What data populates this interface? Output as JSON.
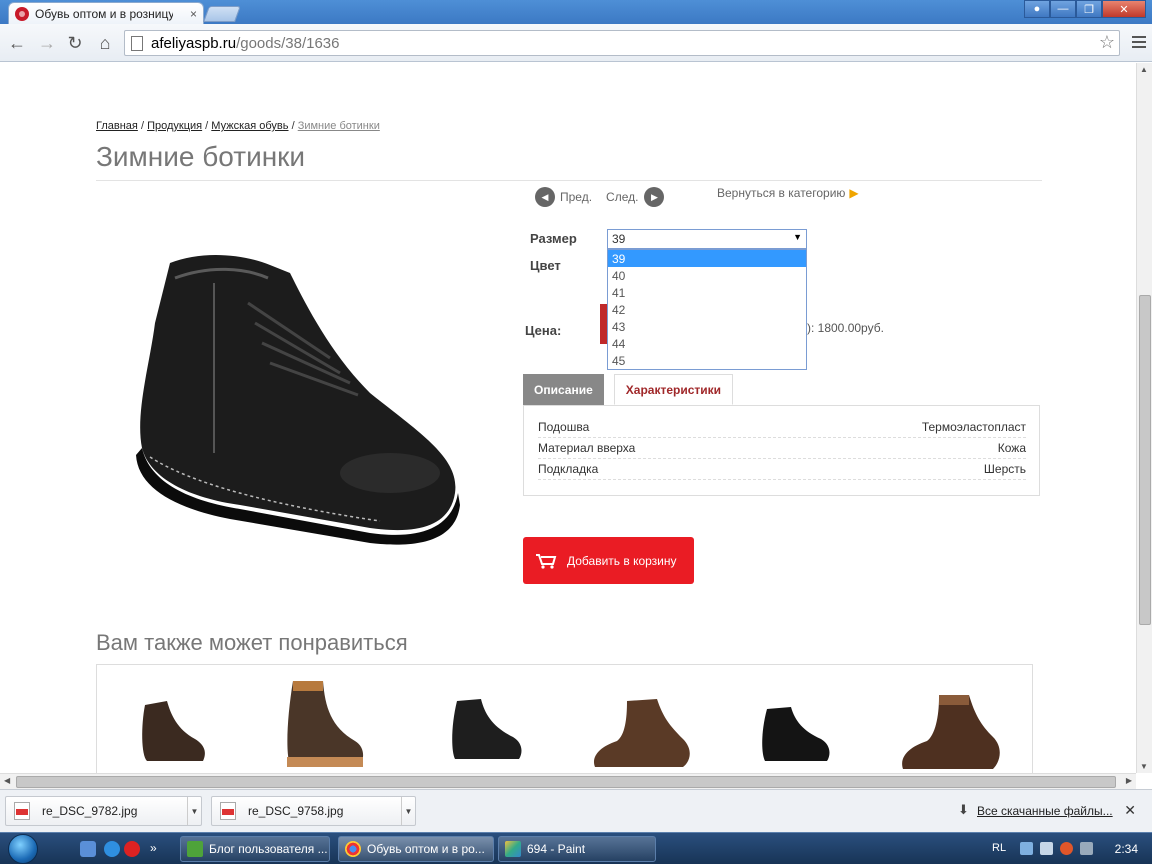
{
  "browser": {
    "tab_title": "Обувь оптом и в розницу",
    "tab_close": "×",
    "url_domain": "afeliyaspb.ru",
    "url_path": "/goods/38/1636"
  },
  "page": {
    "breadcrumb": [
      "Главная",
      "Продукция",
      "Мужская обувь"
    ],
    "breadcrumb_sep": "/",
    "breadcrumb_current": "Зимние ботинки",
    "title": "Зимние ботинки",
    "prev_label": "Пред.",
    "next_label": "След.",
    "back_to_category": "Вернуться в категорию",
    "size_label": "Размер",
    "color_label": "Цвет",
    "price_label": "Цена:",
    "price_partial": "): 1800.00руб.",
    "size_selected": "39",
    "size_options": [
      "39",
      "40",
      "41",
      "42",
      "43",
      "44",
      "45"
    ],
    "tab_description": "Описание",
    "tab_characteristics": "Характеристики",
    "specs": [
      {
        "name": "Подошва",
        "value": "Термоэластопласт"
      },
      {
        "name": "Материал вверха",
        "value": "Кожа"
      },
      {
        "name": "Подкладка",
        "value": "Шерсть"
      }
    ],
    "add_to_cart": "Добавить в корзину",
    "recommend_title": "Вам также может понравиться"
  },
  "downloads": {
    "items": [
      "re_DSC_9782.jpg",
      "re_DSC_9758.jpg"
    ],
    "show_all": "Все скачанные файлы..."
  },
  "taskbar": {
    "tasks": [
      "Блог пользователя ...",
      "Обувь оптом и в ро...",
      "694 - Paint"
    ],
    "language": "RL",
    "time": "2:34"
  },
  "colors": {
    "accent_red": "#ea1c24",
    "tab_active_text": "#a0282a",
    "select_highlight": "#3399ff"
  }
}
